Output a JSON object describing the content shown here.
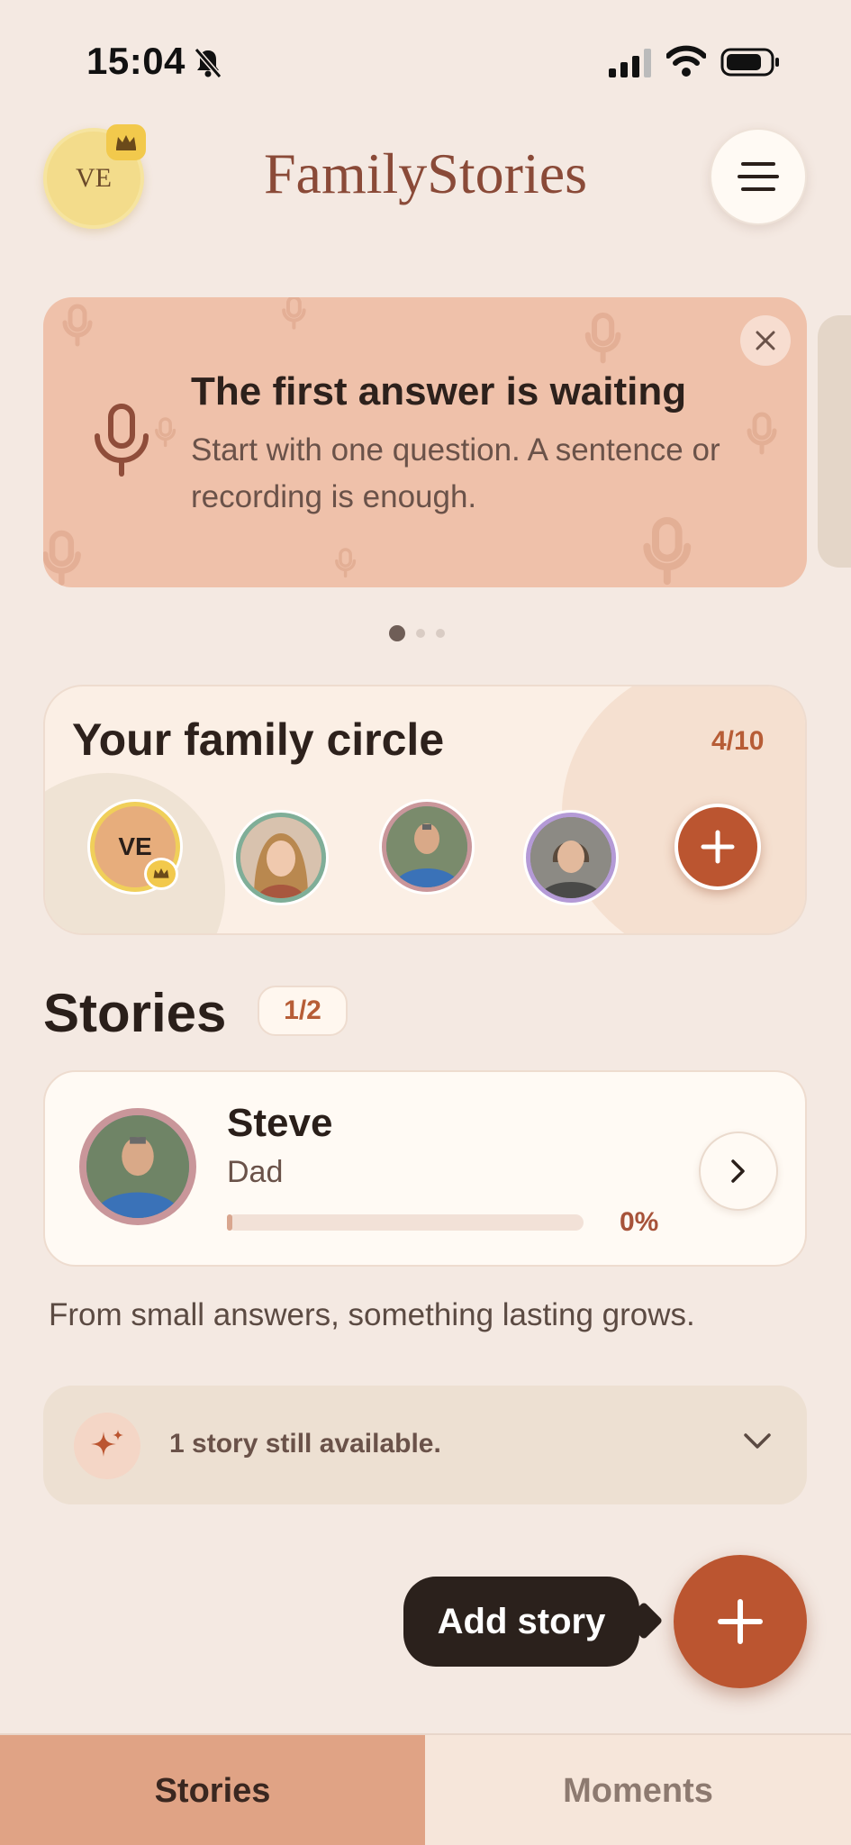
{
  "status_bar": {
    "time": "15:04"
  },
  "header": {
    "user_initials": "VE",
    "app_title": "FamilyStories"
  },
  "banner": {
    "title": "The first answer is waiting",
    "body": "Start with one question. A sentence or recording is enough.",
    "page_count": 3,
    "active_page": 1
  },
  "family_circle": {
    "title": "Your family circle",
    "count": "4/10",
    "owner_initials": "VE"
  },
  "stories": {
    "heading": "Stories",
    "count": "1/2",
    "items": [
      {
        "name": "Steve",
        "role": "Dad",
        "progress": 0,
        "progress_label": "0%"
      }
    ]
  },
  "tagline": "From small answers, something lasting grows.",
  "available": {
    "text": "1 story still available."
  },
  "fab": {
    "label": "Add story"
  },
  "tabs": [
    {
      "label": "Stories",
      "active": true
    },
    {
      "label": "Moments",
      "active": false
    }
  ],
  "colors": {
    "accent": "#bb5530",
    "banner": "#efc1aa",
    "background": "#f4e9e2"
  }
}
